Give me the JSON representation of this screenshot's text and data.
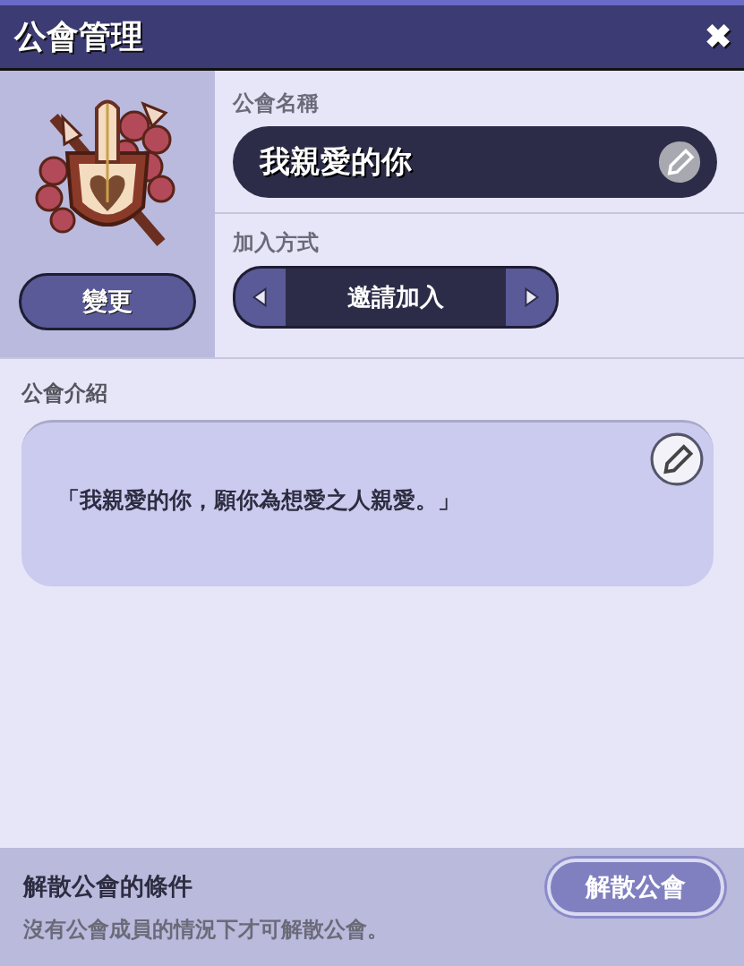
{
  "window": {
    "title": "公會管理",
    "close": "✖"
  },
  "emblem": {
    "change_button": "變更"
  },
  "guild_name": {
    "label": "公會名稱",
    "value": "我親愛的你"
  },
  "join_method": {
    "label": "加入方式",
    "value": "邀請加入"
  },
  "intro": {
    "label": "公會介紹",
    "text": "「我親愛的你，願你為想愛之人親愛。」"
  },
  "disband": {
    "title": "解散公會的條件",
    "note": "沒有公會成員的情況下才可解散公會。",
    "button": "解散公會"
  }
}
